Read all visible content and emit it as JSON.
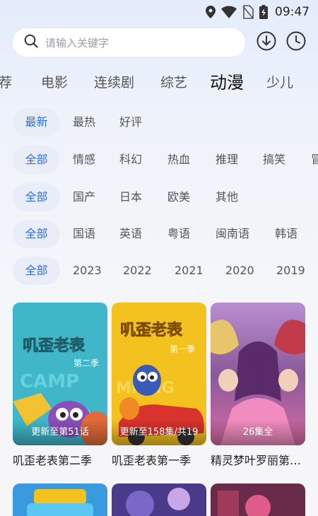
{
  "status_bar": {
    "time": "09:47",
    "icons": [
      "location-icon",
      "wifi-icon",
      "no-sim-icon",
      "battery-charging-icon"
    ]
  },
  "search": {
    "placeholder": "请输入关键字",
    "icon": "search-icon"
  },
  "header_actions": [
    "download-icon",
    "history-clock-icon"
  ],
  "tabs": [
    {
      "label": "推荐",
      "visible_text": "荐",
      "active": false
    },
    {
      "label": "电影",
      "active": false
    },
    {
      "label": "连续剧",
      "active": false
    },
    {
      "label": "综艺",
      "active": false
    },
    {
      "label": "动漫",
      "active": true
    },
    {
      "label": "少儿",
      "active": false
    }
  ],
  "filters": {
    "sort": [
      "最新",
      "最热",
      "好评"
    ],
    "genre": [
      "全部",
      "情感",
      "科幻",
      "热血",
      "推理",
      "搞笑",
      "冒"
    ],
    "region": [
      "全部",
      "国产",
      "日本",
      "欧美",
      "其他"
    ],
    "language": [
      "全部",
      "国语",
      "英语",
      "粤语",
      "闽南语",
      "韩语"
    ],
    "year": [
      "全部",
      "2023",
      "2022",
      "2021",
      "2020",
      "2019"
    ]
  },
  "colors": {
    "accent": "#2f6fe8",
    "chip_selected_bg": "#e8edf7"
  },
  "shows": [
    {
      "title": "叽歪老表第二季",
      "caption": "更新至第51话",
      "poster_logo": "叽歪老表",
      "poster_sub": "第二季"
    },
    {
      "title": "叽歪老表第一季",
      "caption": "更新至158集/共19",
      "poster_logo": "叽歪老表",
      "poster_sub": "第一季"
    },
    {
      "title": "精灵梦叶罗丽第…",
      "caption": "26集全"
    }
  ]
}
